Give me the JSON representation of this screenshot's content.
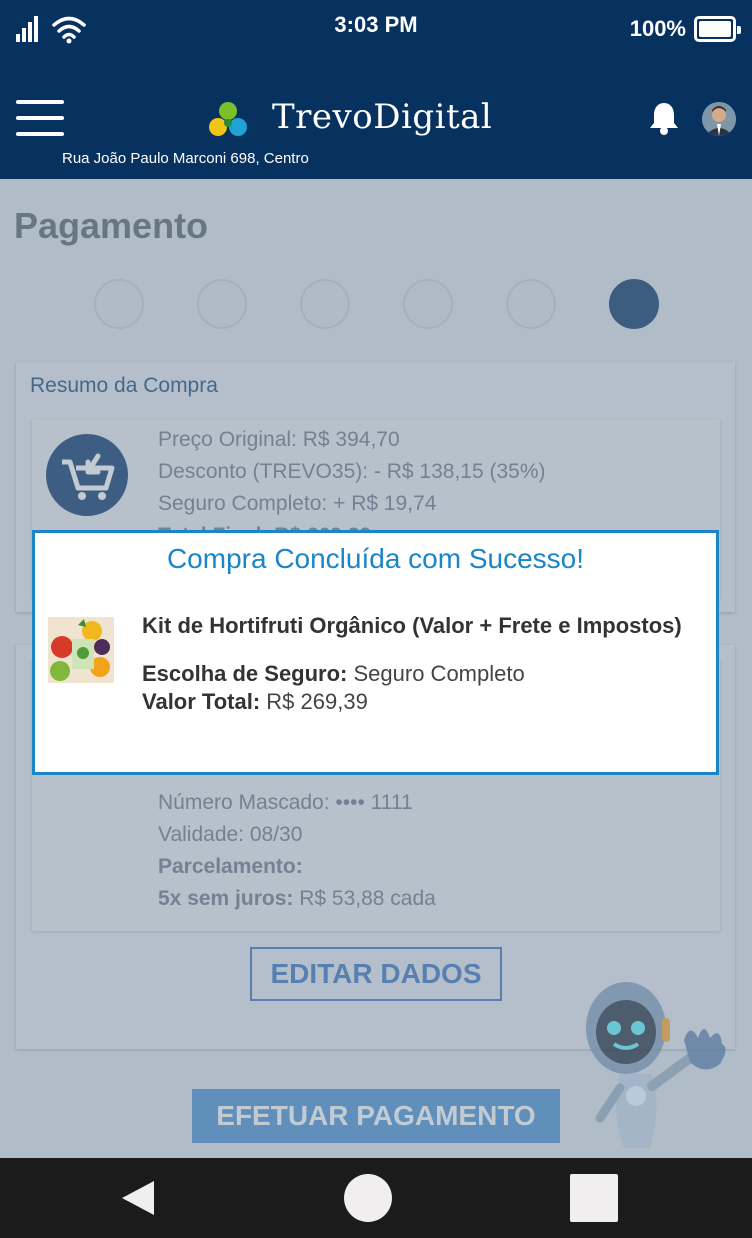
{
  "status_bar": {
    "time": "3:03 PM",
    "battery": "100%"
  },
  "header": {
    "brand": "TrevoDigital",
    "address": "Rua João Paulo Marconi 698, Centro"
  },
  "page": {
    "title": "Pagamento",
    "steps_total": 6,
    "active_step": 6
  },
  "summary": {
    "title": "Resumo da Compra",
    "original_price": "Preço Original: R$ 394,70",
    "discount": "Desconto (TREVO35): - R$ 138,15 (35%)",
    "insurance": "Seguro Completo: + R$ 19,74",
    "total_partial": "Total Final: R$ 269,39"
  },
  "card_info": {
    "masked_label": "Número Mascado:",
    "masked_value": " •••• 1111",
    "validity_label": "Validade:",
    "validity_value": " 08/30",
    "installments_label": "Parcelamento:",
    "installments_plan_label": "5x sem juros:",
    "installments_plan_value": " R$ 53,88 cada"
  },
  "buttons": {
    "edit": "EDITAR DADOS",
    "pay": "EFETUAR PAGAMENTO"
  },
  "modal": {
    "title": "Compra Concluída com Sucesso!",
    "product": "Kit de Hortifruti Orgânico (Valor + Frete e Impostos)",
    "insurance_label": "Escolha de Seguro:",
    "insurance_value": " Seguro Completo",
    "total_label": "Valor Total:",
    "total_value": " R$ 269,39"
  },
  "colors": {
    "header_bg": "#07325f",
    "accent": "#1a86c8",
    "button_blue": "#4e94d6"
  }
}
